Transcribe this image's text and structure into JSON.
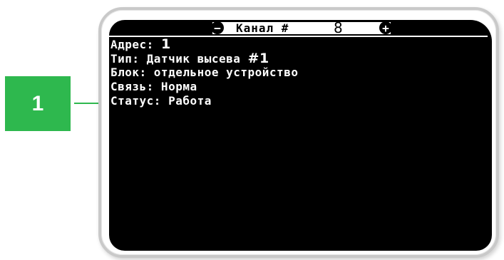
{
  "callout": {
    "number": "1",
    "color": "#2eb84e"
  },
  "header": {
    "minus_symbol": "−",
    "title": "Канал #",
    "channel_number": "8",
    "plus_symbol": "+"
  },
  "info": {
    "address_label": "Адрес: ",
    "address_value": "1",
    "type_label": "Тип: Датчик высева ",
    "type_value": "#1",
    "block": "Блок: отдельное устройство",
    "link": "Связь: Норма",
    "status": "Статус: Работа"
  }
}
